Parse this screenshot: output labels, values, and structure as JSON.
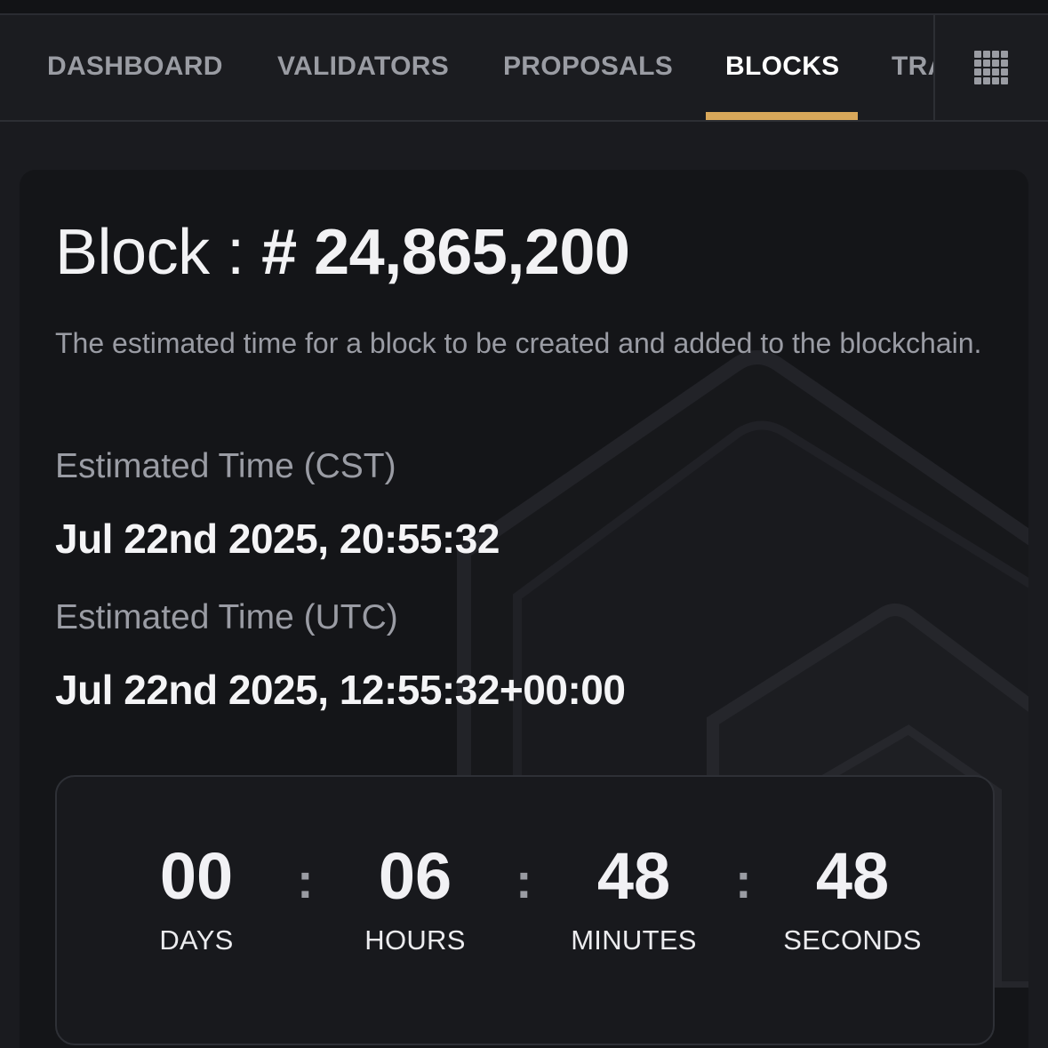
{
  "nav": {
    "tabs": [
      {
        "label": "DASHBOARD"
      },
      {
        "label": "VALIDATORS"
      },
      {
        "label": "PROPOSALS"
      },
      {
        "label": "BLOCKS"
      },
      {
        "label": "TRANSACTIONS"
      }
    ],
    "active_tab": "BLOCKS"
  },
  "block": {
    "title_prefix": "Block : ",
    "number": "# 24,865,200",
    "description": "The estimated time for a block to be created and added to the blockchain.",
    "cst_label": "Estimated Time (CST)",
    "cst_value": "Jul 22nd 2025, 20:55:32",
    "utc_label": "Estimated Time (UTC)",
    "utc_value": "Jul 22nd 2025, 12:55:32+00:00"
  },
  "countdown": {
    "days": {
      "value": "00",
      "label": "DAYS"
    },
    "hours": {
      "value": "06",
      "label": "HOURS"
    },
    "minutes": {
      "value": "48",
      "label": "MINUTES"
    },
    "seconds": {
      "value": "48",
      "label": "SECONDS"
    },
    "separator": ":"
  },
  "colors": {
    "background": "#1a1b1f",
    "card": "#141518",
    "accent": "#d9a85a",
    "muted_text": "#9a9ca4"
  },
  "icons": {
    "apps": "grid-icon",
    "watermark": "logo-watermark-icon"
  }
}
